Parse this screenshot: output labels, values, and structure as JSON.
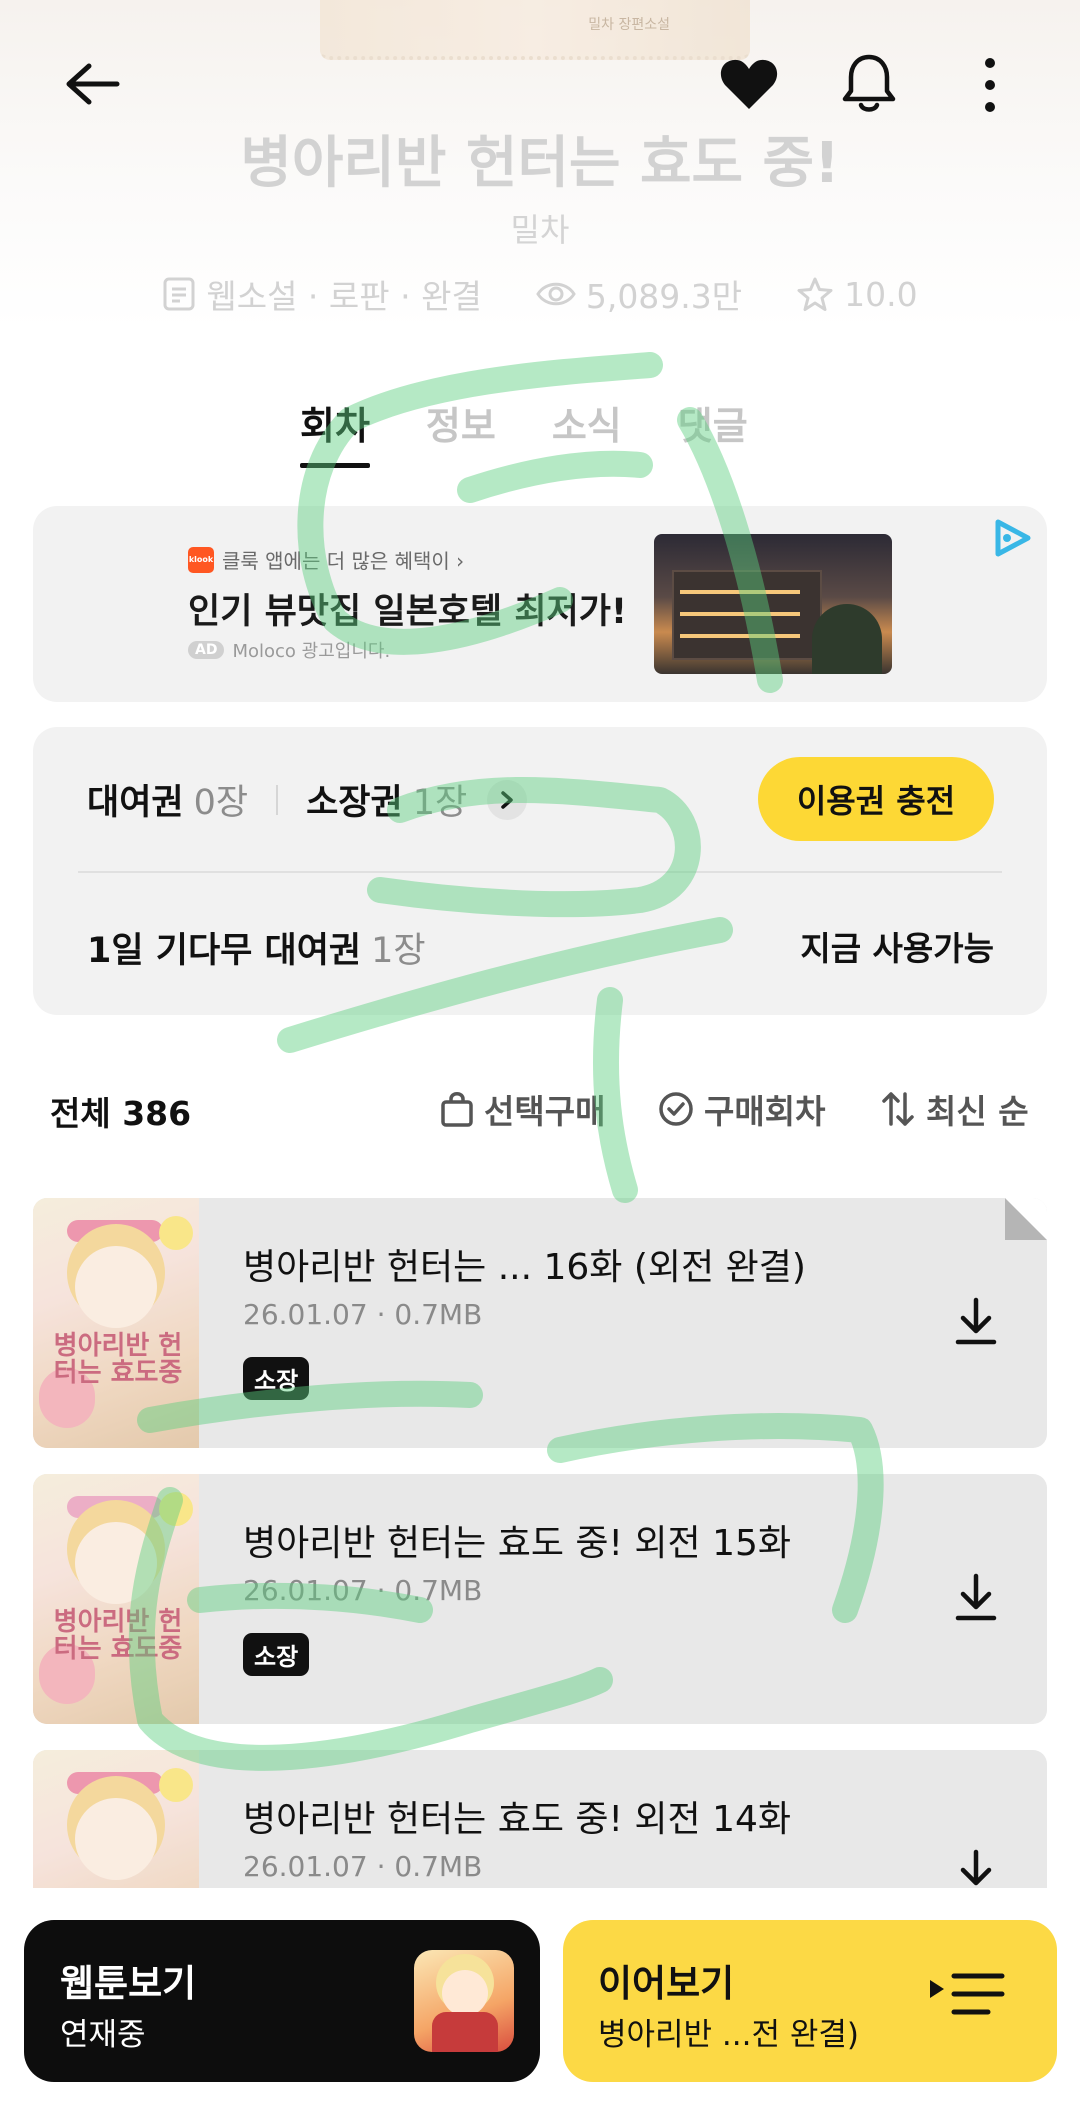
{
  "header": {
    "cover_text": "밀차 장편소설",
    "title": "병아리반 헌터는 효도 중!",
    "author": "밀차",
    "genre": "웹소설 · 로판 · 완결",
    "views": "5,089.3만",
    "rating": "10.0",
    "icons": [
      "back-arrow-icon",
      "heart-icon",
      "bell-icon",
      "more-vertical-icon"
    ]
  },
  "tabs": [
    "회차",
    "정보",
    "소식",
    "댓글"
  ],
  "ad": {
    "brand": "klook",
    "tagline": "클룩 앱에는 더 많은 혜택이 ›",
    "headline": "인기 뷰맛집 일본호텔 최저가!",
    "badge": "AD",
    "disclosure": "Moloco 광고입니다."
  },
  "tickets": {
    "rental_label": "대여권",
    "rental_count": "0장",
    "own_label": "소장권",
    "own_count": "1장",
    "charge_button": "이용권 충전",
    "wait_label": "1일 기다무 대여권",
    "wait_count": "1장",
    "wait_status": "지금 사용가능"
  },
  "list": {
    "total": "전체 386",
    "select_buy": "선택구매",
    "purchased": "구매회차",
    "sort": "최신 순"
  },
  "episodes": [
    {
      "title": "병아리반 헌터는 ... 16화 (외전 완결)",
      "date": "26.01.07",
      "size": "0.7MB",
      "badge": "소장"
    },
    {
      "title": "병아리반 헌터는 효도 중! 외전 15화",
      "date": "26.01.07",
      "size": "0.7MB",
      "badge": "소장"
    },
    {
      "title": "병아리반 헌터는 효도 중! 외전 14화",
      "date": "26.01.07",
      "size": "0.7MB",
      "badge": ""
    }
  ],
  "thumb_logo": "병아리반 헌터는 효도중",
  "bottom": {
    "webtoon_title": "웹툰보기",
    "webtoon_status": "연재중",
    "continue_title": "이어보기",
    "continue_sub": "병아리반 ...전 완결)"
  },
  "colors": {
    "accent": "#fdd835",
    "continue": "#fcd945",
    "watermark": "#5ccf7e"
  }
}
